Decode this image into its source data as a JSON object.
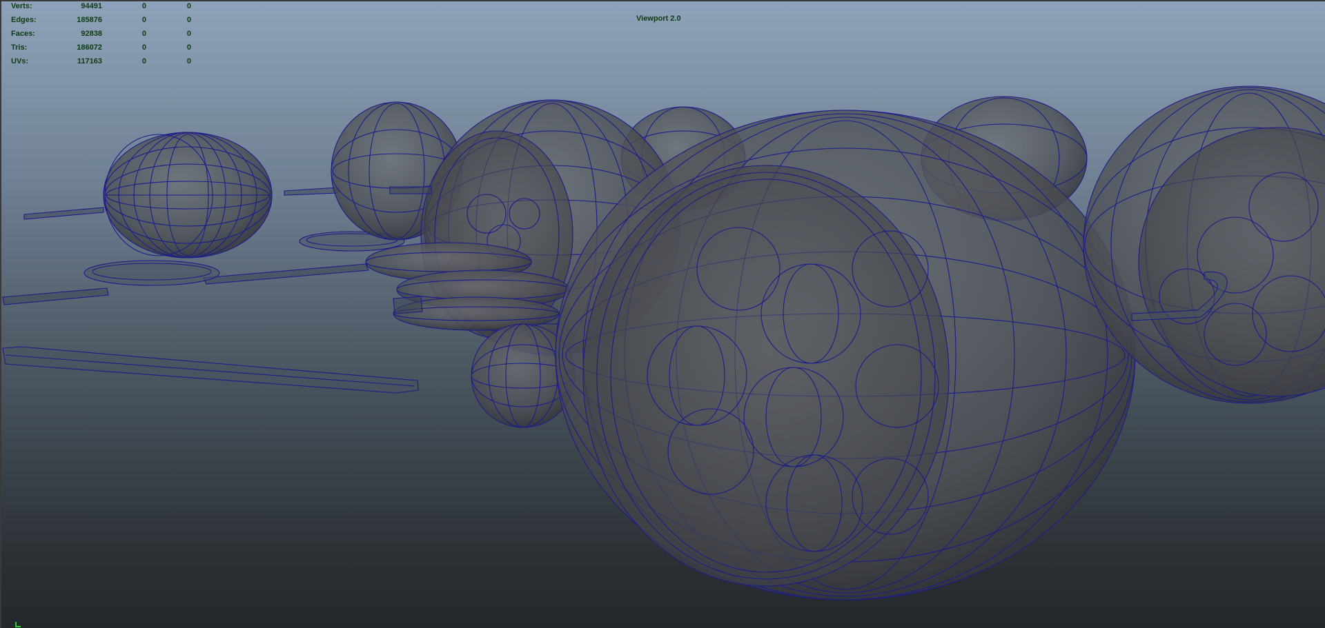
{
  "viewport": {
    "title": "Viewport 2.0"
  },
  "hud": {
    "rows": [
      {
        "label": "Verts:",
        "v1": "94491",
        "v2": "0",
        "v3": "0"
      },
      {
        "label": "Edges:",
        "v1": "185876",
        "v2": "0",
        "v3": "0"
      },
      {
        "label": "Faces:",
        "v1": "92838",
        "v2": "0",
        "v3": "0"
      },
      {
        "label": "Tris:",
        "v1": "186072",
        "v2": "0",
        "v3": "0"
      },
      {
        "label": "UVs:",
        "v1": "117163",
        "v2": "0",
        "v3": "0"
      }
    ]
  },
  "colors": {
    "wireframe": "#1c1c8a",
    "hud_text": "#0d3b12",
    "axis_green": "#2ecc40"
  }
}
